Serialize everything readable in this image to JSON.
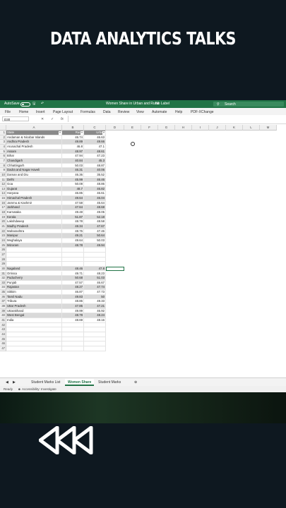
{
  "headline": "DATA ANALYTICS TALKS",
  "excel": {
    "autosave": "AutoSave",
    "autosave_state": "Off",
    "doc_title": "Women Share in Urban and Rural",
    "sensitivity": "No Label",
    "search_placeholder": "Search",
    "menu": [
      "File",
      "Home",
      "Insert",
      "Page Layout",
      "Formulas",
      "Data",
      "Review",
      "View",
      "Automate",
      "Help",
      "PDF-XChange"
    ],
    "name_box": "D30",
    "fx": "fx",
    "columns": [
      "A",
      "B",
      "C",
      "D",
      "E",
      "F",
      "G",
      "H",
      "I",
      "J",
      "K",
      "L",
      "M"
    ],
    "headers": [
      "State",
      "Rural",
      "Urban"
    ],
    "rows": [
      {
        "n": "1"
      },
      {
        "n": "2",
        "state": "Andaman & Nicobar Islands",
        "rural": "46.74",
        "urban": "46.63"
      },
      {
        "n": "3",
        "state": "Andhra Pradesh",
        "rural": "49.89",
        "urban": "49.66"
      },
      {
        "n": "4",
        "state": "Arunachal Pradesh",
        "rural": "46.8",
        "urban": "47.1"
      },
      {
        "n": "5",
        "state": "Assam",
        "rural": "48.97",
        "urban": "48.61"
      },
      {
        "n": "6",
        "state": "Bihar",
        "rural": "47.94",
        "urban": "47.23"
      },
      {
        "n": "7",
        "state": "Chandigarh",
        "rural": "40.84",
        "urban": "45.3"
      },
      {
        "n": "8",
        "state": "Chhattisgarh",
        "rural": "50.03",
        "urban": "48.87"
      },
      {
        "n": "9",
        "state": "Dadra and Nagar Haveli",
        "rural": "46.31",
        "urban": "40.06"
      },
      {
        "n": "10",
        "state": "Daman and Diu",
        "rural": "46.36",
        "urban": "35.52"
      },
      {
        "n": "11",
        "state": "Delhi",
        "rural": "45.99",
        "urban": "46.46"
      },
      {
        "n": "12",
        "state": "Goa",
        "rural": "50.08",
        "urban": "48.86"
      },
      {
        "n": "13",
        "state": "Gujarat",
        "rural": "48.7",
        "urban": "46.82"
      },
      {
        "n": "14",
        "state": "Haryana",
        "rural": "46.85",
        "urban": "46.61"
      },
      {
        "n": "15",
        "state": "Himachal Pradesh",
        "rural": "49.64",
        "urban": "46.04"
      },
      {
        "n": "16",
        "state": "Jammu & Kashmir",
        "rural": "47.58",
        "urban": "45.64"
      },
      {
        "n": "17",
        "state": "Jarkhand",
        "rural": "47.64",
        "urban": "48.68"
      },
      {
        "n": "18",
        "state": "Karnataka",
        "rural": "49.48",
        "urban": "49.05"
      },
      {
        "n": "19",
        "state": "Kerala",
        "rural": "51.87",
        "urban": "52.18"
      },
      {
        "n": "20",
        "state": "Lakshdweep",
        "rural": "48.78",
        "urban": "48.58"
      },
      {
        "n": "21",
        "state": "Madhy Pradesh",
        "rural": "48.34",
        "urban": "47.67"
      },
      {
        "n": "22",
        "state": "Maharashtra",
        "rural": "48.76",
        "urban": "47.46"
      },
      {
        "n": "23",
        "state": "Manipur",
        "rural": "49.21",
        "urban": "50.64"
      },
      {
        "n": "24",
        "state": "Meghalaya",
        "rural": "49.64",
        "urban": "50.03"
      },
      {
        "n": "25",
        "state": "Mizoram",
        "rural": "48.78",
        "urban": "49.94"
      },
      {
        "n": "26"
      },
      {
        "n": "27"
      },
      {
        "n": "28"
      },
      {
        "n": "29"
      },
      {
        "n": "30",
        "state": "Nagaland",
        "rural": "48.46",
        "urban": "47.8"
      },
      {
        "n": "31",
        "state": "Orrissa",
        "rural": "49.71",
        "urban": "48.23"
      },
      {
        "n": "32",
        "state": "Puducherry",
        "rural": "50.68",
        "urban": "51.03"
      },
      {
        "n": "33",
        "state": "Punjab",
        "rural": "47.57",
        "urban": "46.67"
      },
      {
        "n": "34",
        "state": "Rajastan",
        "rural": "48.27",
        "urban": "47.74"
      },
      {
        "n": "35",
        "state": "Sikkim",
        "rural": "46.87",
        "urban": "47.73"
      },
      {
        "n": "36",
        "state": "Tamil Nadu",
        "rural": "49.83",
        "urban": "50"
      },
      {
        "n": "37",
        "state": "Tribura",
        "rural": "48.86",
        "urban": "49.33"
      },
      {
        "n": "38",
        "state": "Uttar Pradesh",
        "rural": "47.85",
        "urban": "47.21"
      },
      {
        "n": "39",
        "state": "Uttarakhand",
        "rural": "49.99",
        "urban": "46.92"
      },
      {
        "n": "40",
        "state": "West Bengal",
        "rural": "48.79",
        "urban": "48.24"
      },
      {
        "n": "41",
        "state": "India",
        "rural": "48.69",
        "urban": "48.16"
      },
      {
        "n": "42"
      },
      {
        "n": "43"
      },
      {
        "n": "44"
      },
      {
        "n": "45"
      },
      {
        "n": "46"
      },
      {
        "n": "47"
      }
    ],
    "sheet_tabs": [
      "Student Marks List",
      "Women Share",
      "Student Marks"
    ],
    "active_tab": "Women Share",
    "status_ready": "Ready",
    "status_accessibility": "Accessibility: Investigate",
    "accent_color": "#217346"
  }
}
